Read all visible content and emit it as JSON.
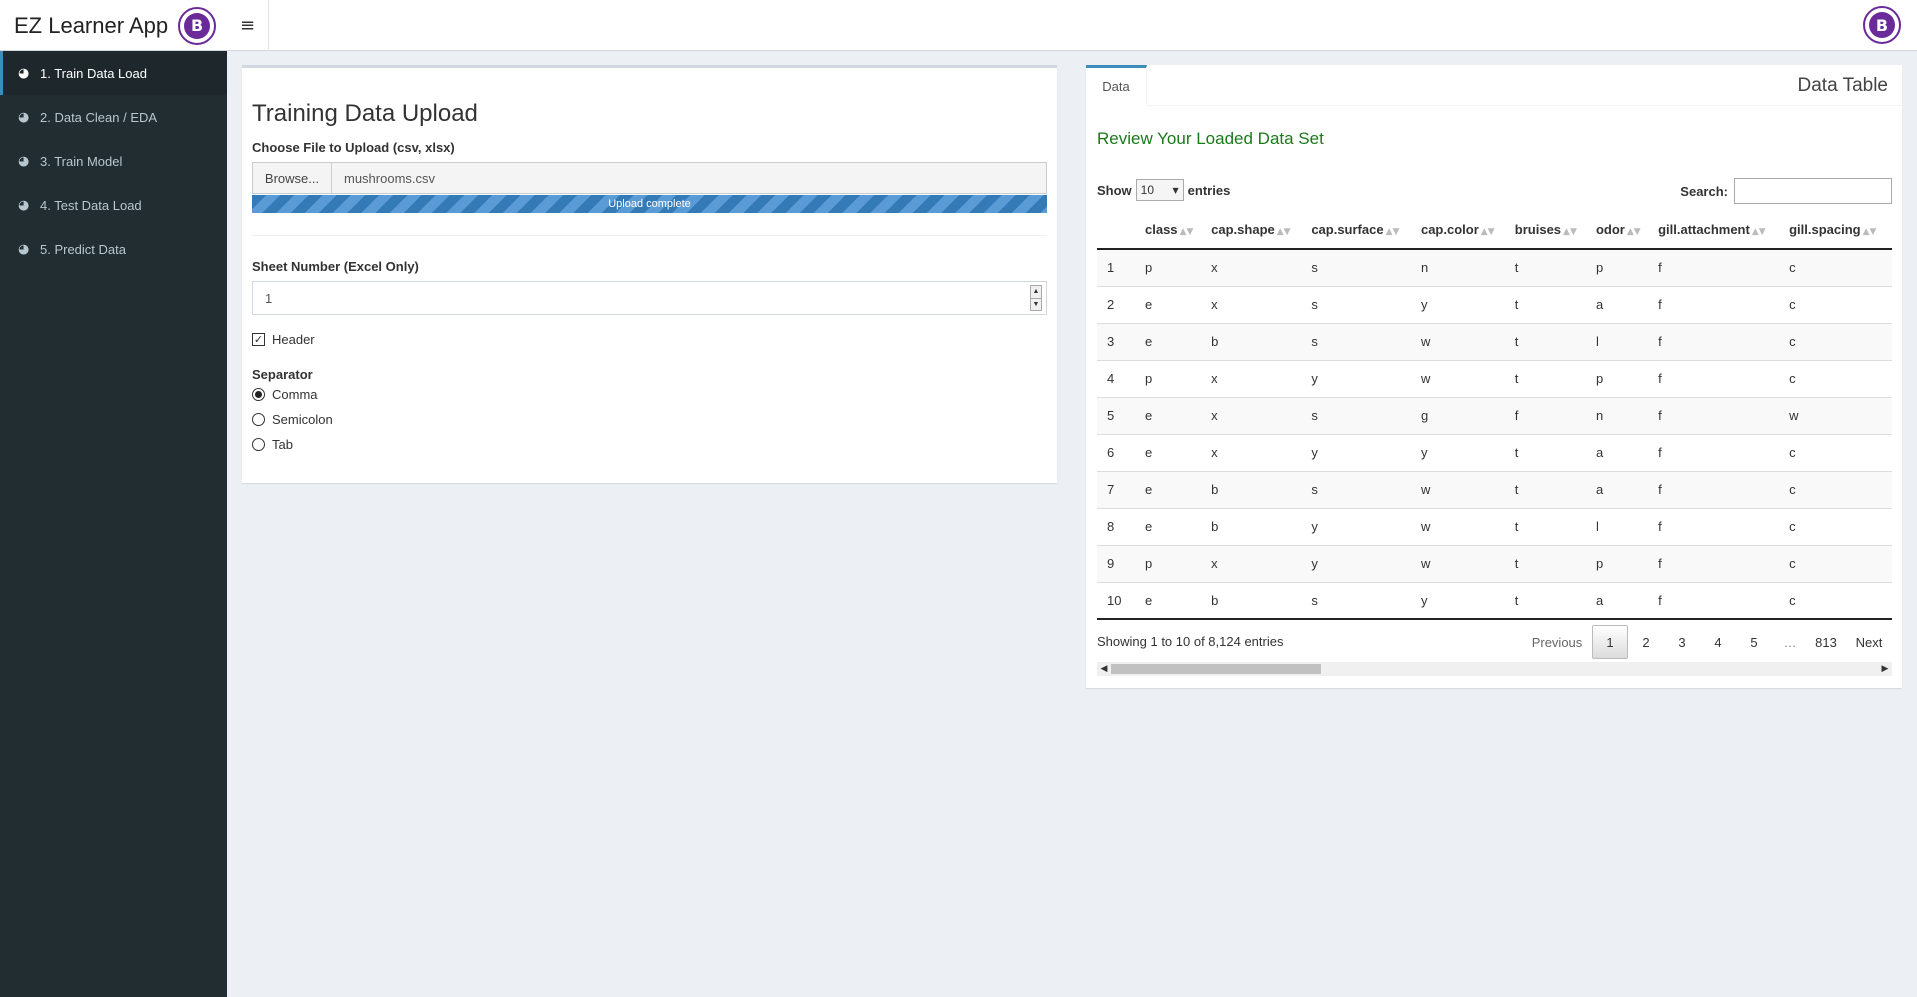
{
  "header": {
    "app_title": "EZ Learner App",
    "menu_icon": "hamburger-icon",
    "logo_letter": "B"
  },
  "sidebar": {
    "items": [
      {
        "label": "1. Train Data Load",
        "active": true
      },
      {
        "label": "2. Data Clean / EDA",
        "active": false
      },
      {
        "label": "3. Train Model",
        "active": false
      },
      {
        "label": "4. Test Data Load",
        "active": false
      },
      {
        "label": "5. Predict Data",
        "active": false
      }
    ]
  },
  "upload": {
    "title": "Training Data Upload",
    "file_label": "Choose File to Upload (csv, xlsx)",
    "browse_label": "Browse...",
    "file_name": "mushrooms.csv",
    "progress_text": "Upload complete",
    "progress_percent": 100,
    "sheet_label": "Sheet Number (Excel Only)",
    "sheet_value": "1",
    "header_label": "Header",
    "header_checked": true,
    "separator_label": "Separator",
    "separators": [
      {
        "label": "Comma",
        "selected": true
      },
      {
        "label": "Semicolon",
        "selected": false
      },
      {
        "label": "Tab",
        "selected": false
      }
    ]
  },
  "data_panel": {
    "tab_label": "Data",
    "box_title": "Data Table",
    "review_text": "Review Your Loaded Data Set",
    "show_label": "Show",
    "page_length": "10",
    "entries_label": "entries",
    "search_label": "Search:",
    "search_value": "",
    "columns": [
      "",
      "class",
      "cap.shape",
      "cap.surface",
      "cap.color",
      "bruises",
      "odor",
      "gill.attachment",
      "gill.spacing"
    ],
    "rows": [
      [
        "1",
        "p",
        "x",
        "s",
        "n",
        "t",
        "p",
        "f",
        "c"
      ],
      [
        "2",
        "e",
        "x",
        "s",
        "y",
        "t",
        "a",
        "f",
        "c"
      ],
      [
        "3",
        "e",
        "b",
        "s",
        "w",
        "t",
        "l",
        "f",
        "c"
      ],
      [
        "4",
        "p",
        "x",
        "y",
        "w",
        "t",
        "p",
        "f",
        "c"
      ],
      [
        "5",
        "e",
        "x",
        "s",
        "g",
        "f",
        "n",
        "f",
        "w"
      ],
      [
        "6",
        "e",
        "x",
        "y",
        "y",
        "t",
        "a",
        "f",
        "c"
      ],
      [
        "7",
        "e",
        "b",
        "s",
        "w",
        "t",
        "a",
        "f",
        "c"
      ],
      [
        "8",
        "e",
        "b",
        "y",
        "w",
        "t",
        "l",
        "f",
        "c"
      ],
      [
        "9",
        "p",
        "x",
        "y",
        "w",
        "t",
        "p",
        "f",
        "c"
      ],
      [
        "10",
        "e",
        "b",
        "s",
        "y",
        "t",
        "a",
        "f",
        "c"
      ]
    ],
    "info_text": "Showing 1 to 10 of 8,124 entries",
    "pagination": {
      "previous": "Previous",
      "pages": [
        "1",
        "2",
        "3",
        "4",
        "5"
      ],
      "current": "1",
      "ellipsis": "…",
      "last": "813",
      "next": "Next"
    }
  }
}
